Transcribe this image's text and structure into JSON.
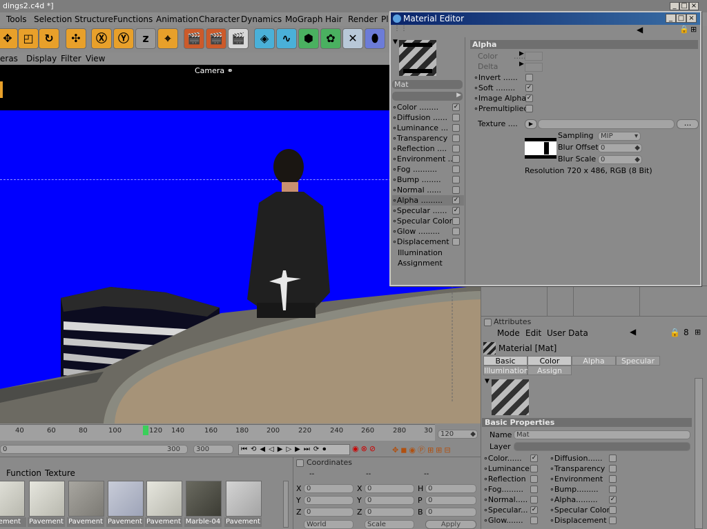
{
  "window": {
    "title": "dings2.c4d *]"
  },
  "menubar": {
    "items": [
      "Tools",
      "Selection",
      "Structure",
      "Functions",
      "Animation",
      "Character",
      "Dynamics",
      "MoGraph",
      "Hair",
      "Render",
      "Pl"
    ]
  },
  "viewport": {
    "menu": [
      "eras",
      "Display",
      "Filter",
      "View"
    ],
    "camera_label": "Camera",
    "bg": "#0000ff"
  },
  "timeline": {
    "ticks": [
      "40",
      "60",
      "80",
      "100",
      "120",
      "140",
      "160",
      "180",
      "200",
      "220",
      "240",
      "260",
      "280",
      "30"
    ],
    "current_frame": "120",
    "start": "0",
    "end": "300",
    "end_field": "300"
  },
  "material_editor": {
    "title": "Material Editor",
    "material_name": "Mat",
    "channels": [
      {
        "label": "Color",
        "checked": "✓"
      },
      {
        "label": "Diffusion",
        "checked": ""
      },
      {
        "label": "Luminance",
        "checked": ""
      },
      {
        "label": "Transparency",
        "checked": ""
      },
      {
        "label": "Reflection",
        "checked": ""
      },
      {
        "label": "Environment",
        "checked": ""
      },
      {
        "label": "Fog",
        "checked": ""
      },
      {
        "label": "Bump",
        "checked": ""
      },
      {
        "label": "Normal",
        "checked": ""
      },
      {
        "label": "Alpha",
        "checked": "✓"
      },
      {
        "label": "Specular",
        "checked": "✓"
      },
      {
        "label": "Specular Color",
        "checked": ""
      },
      {
        "label": "Glow",
        "checked": ""
      },
      {
        "label": "Displacement",
        "checked": ""
      }
    ],
    "illumination": "Illumination",
    "assignment": "Assignment",
    "alpha": {
      "header": "Alpha",
      "color": "Color",
      "delta": "Delta",
      "invert": "Invert",
      "soft": "Soft",
      "image_alpha": "Image Alpha",
      "premultiplied": "Premultiplied",
      "texture": "Texture",
      "sampling_label": "Sampling",
      "sampling_value": "MIP",
      "blur_offset_label": "Blur Offset",
      "blur_offset_value": "0",
      "blur_scale_label": "Blur Scale",
      "blur_scale_value": "0",
      "resolution": "Resolution 720 x 486, RGB (8 Bit)",
      "browse": "..."
    }
  },
  "attributes": {
    "title": "Attributes",
    "menu": [
      "Mode",
      "Edit",
      "User Data"
    ],
    "object": "Material [Mat]",
    "tabs": [
      "Basic",
      "Color",
      "Alpha",
      "Specular",
      "Illumination",
      "Assign"
    ],
    "section": "Basic Properties",
    "name_label": "Name",
    "name_value": "Mat",
    "layer_label": "Layer",
    "left": [
      {
        "label": "Color",
        "checked": "✓"
      },
      {
        "label": "Luminance",
        "checked": ""
      },
      {
        "label": "Reflection",
        "checked": ""
      },
      {
        "label": "Fog",
        "checked": ""
      },
      {
        "label": "Normal",
        "checked": ""
      },
      {
        "label": "Specular",
        "checked": "✓"
      },
      {
        "label": "Glow",
        "checked": ""
      }
    ],
    "right": [
      {
        "label": "Diffusion",
        "checked": ""
      },
      {
        "label": "Transparency",
        "checked": ""
      },
      {
        "label": "Environment",
        "checked": ""
      },
      {
        "label": "Bump",
        "checked": ""
      },
      {
        "label": "Alpha",
        "checked": "✓"
      },
      {
        "label": "Specular Color",
        "checked": ""
      },
      {
        "label": "Displacement",
        "checked": ""
      }
    ]
  },
  "material_manager": {
    "menu": [
      "Function",
      "Texture"
    ],
    "items": [
      "vement",
      "Pavement",
      "Pavement",
      "Pavement",
      "Pavement",
      "Marble-04",
      "Pavement"
    ]
  },
  "coordinates": {
    "title": "Coordinates",
    "dash1": "--",
    "dash2": "--",
    "dash3": "--",
    "axes": [
      "X",
      "Y",
      "Z"
    ],
    "sizes": [
      "X",
      "Y",
      "Z"
    ],
    "rots": [
      "H",
      "P",
      "B"
    ],
    "zero": "0",
    "world": "World",
    "scale": "Scale",
    "apply": "Apply"
  }
}
